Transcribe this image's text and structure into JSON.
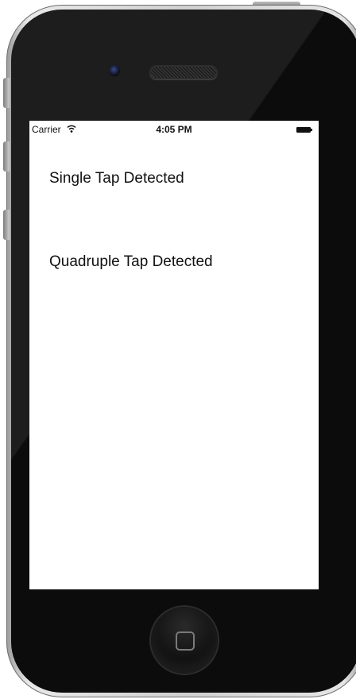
{
  "status_bar": {
    "carrier": "Carrier",
    "time": "4:05 PM",
    "wifi_icon": "wifi-icon",
    "battery_icon": "battery-icon"
  },
  "main": {
    "single_tap_label": "Single Tap Detected",
    "quadruple_tap_label": "Quadruple Tap Detected"
  },
  "device": {
    "home_button_icon": "home-button-icon",
    "frame_color": "#0c0c0c",
    "screen_color": "#ffffff"
  }
}
